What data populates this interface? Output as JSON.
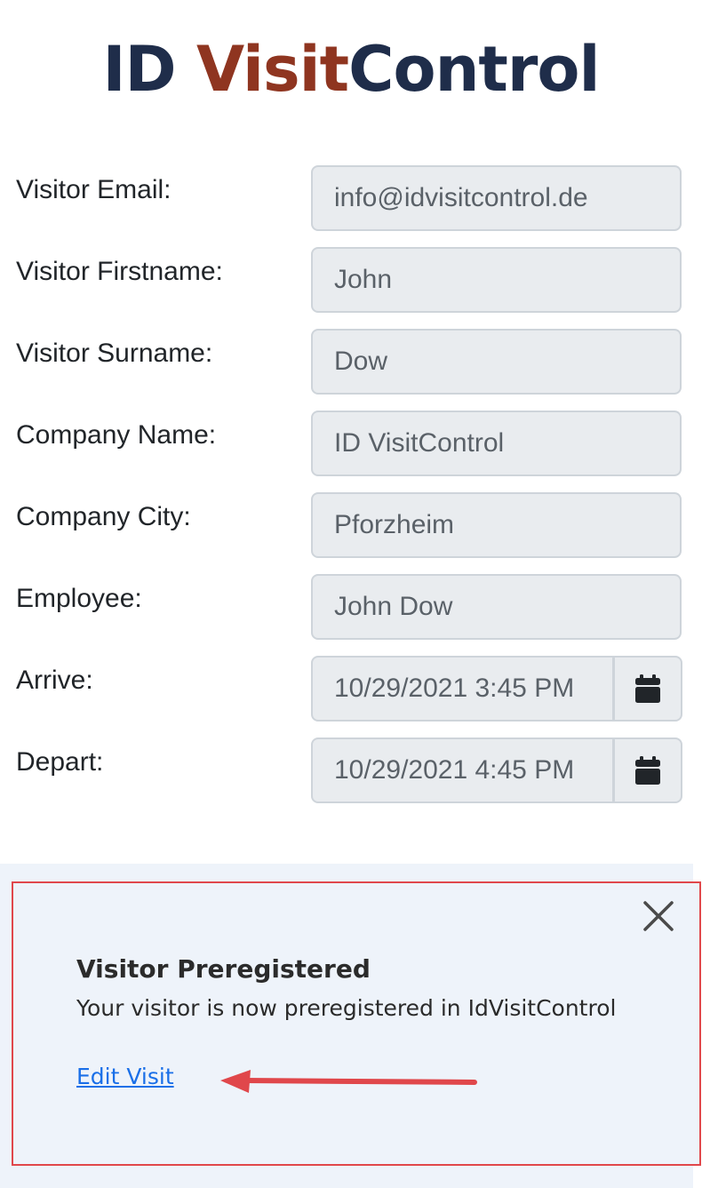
{
  "logo": {
    "part1": "ID ",
    "part2": "Visit",
    "part3": "Control"
  },
  "form": {
    "fields": [
      {
        "label": "Visitor Email:",
        "value": "info@idvisitcontrol.de"
      },
      {
        "label": "Visitor Firstname:",
        "value": "John"
      },
      {
        "label": "Visitor Surname:",
        "value": "Dow"
      },
      {
        "label": "Company Name:",
        "value": "ID VisitControl"
      },
      {
        "label": "Company City:",
        "value": "Pforzheim"
      },
      {
        "label": "Employee:",
        "value": "John Dow"
      },
      {
        "label": "Arrive:",
        "value": "10/29/2021 3:45 PM",
        "icon": "calendar-icon"
      },
      {
        "label": "Depart:",
        "value": "10/29/2021 4:45 PM",
        "icon": "calendar-icon"
      }
    ]
  },
  "toast": {
    "title": "Visitor Preregistered",
    "message": "Your visitor is now preregistered in IdVisitControl",
    "link": "Edit Visit",
    "close_icon": "close-icon",
    "highlight_color": "#e0474b",
    "arrow_color": "#e0474b",
    "link_color": "#1a6fe8"
  }
}
